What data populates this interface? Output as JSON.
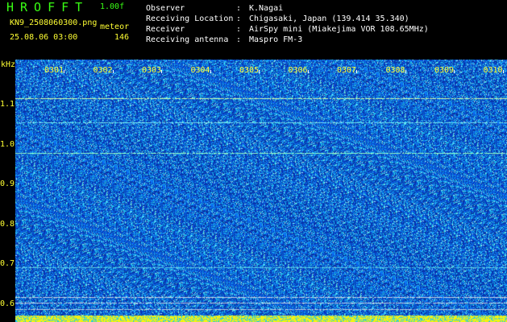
{
  "header": {
    "app_title": "HROFFT",
    "version": "1.00f",
    "filename": "KN9_2508060300.png",
    "datetime": "25.08.06 03:00",
    "meteor_label": "meteor",
    "meteor_count": "146"
  },
  "info": [
    {
      "key": "Observer",
      "value": "K.Nagai"
    },
    {
      "key": "Receiving Location",
      "value": "Chigasaki, Japan (139.414 35.340)"
    },
    {
      "key": "Receiver",
      "value": "AirSpy mini (Miakejima VOR 108.65MHz)"
    },
    {
      "key": "Receiving antenna",
      "value": "Maspro FM-3"
    }
  ],
  "axis": {
    "y_unit": "kHz",
    "y_ticks": [
      "1.1",
      "1.0",
      "0.9",
      "0.8",
      "0.7",
      "0.6"
    ],
    "x_ticks": [
      "0301",
      "0302",
      "0303",
      "0304",
      "0305",
      "0306",
      "0307",
      "0308",
      "0309",
      "0310"
    ]
  },
  "colors": {
    "background": "#000000",
    "green_text": "#39ff14",
    "yellow_text": "#ffff33",
    "white_text": "#ffffff",
    "noise_blue": "#0a3aa0"
  }
}
